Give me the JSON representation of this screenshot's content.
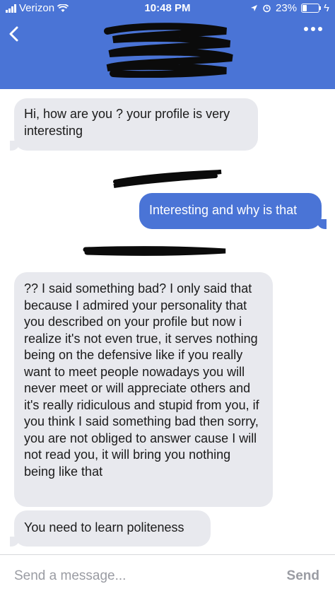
{
  "status_bar": {
    "carrier": "Verizon",
    "time": "10:48 PM",
    "battery": "23%"
  },
  "header": {
    "back_icon": "chevron-left-icon",
    "more_icon": "more-dots-icon"
  },
  "messages": [
    {
      "side": "received",
      "text": "Hi, how are you ? your profile is very interesting"
    },
    {
      "side": "sent",
      "text": "Interesting and why is that"
    },
    {
      "side": "received",
      "text": "?? I said something bad? I only said that because I admired your personality that you described on your profile but now i realize it's not even true, it serves nothing being on the defensive like if you really want to meet people nowadays you will never meet or will  appreciate others and it's really ridiculous and stupid from you, if you think I said something bad then sorry, you are not obliged to answer cause I will not read you, it will bring you nothing being like that"
    },
    {
      "side": "received",
      "text": "You need to learn politeness"
    }
  ],
  "composer": {
    "placeholder": "Send a message...",
    "send_label": "Send"
  },
  "colors": {
    "header": "#4a74d6",
    "sent_bubble": "#4a74d6",
    "received_bubble": "#e8e9ee"
  }
}
